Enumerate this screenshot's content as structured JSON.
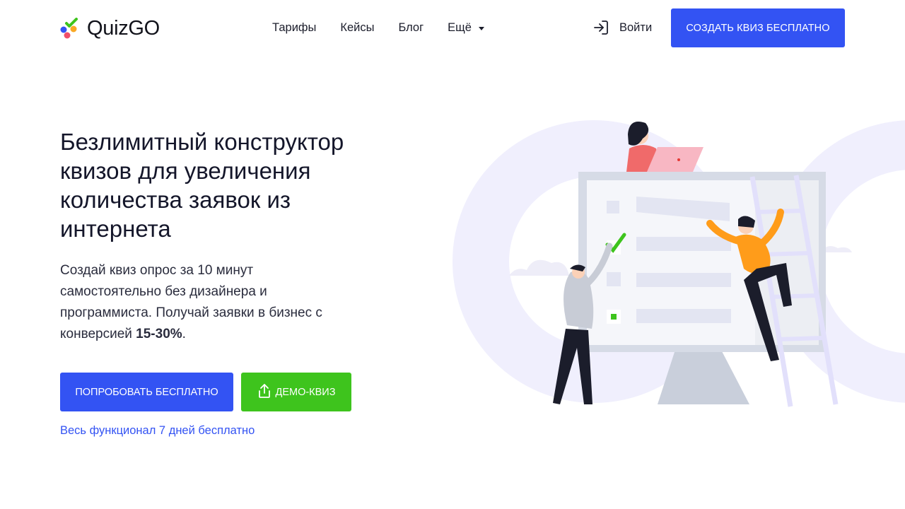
{
  "header": {
    "logo_text": "QuizGO",
    "nav": [
      {
        "label": "Тарифы"
      },
      {
        "label": "Кейсы"
      },
      {
        "label": "Блог"
      },
      {
        "label": "Ещё"
      }
    ],
    "login_label": "Войти",
    "cta_label": "СОЗДАТЬ КВИЗ БЕСПЛАТНО"
  },
  "hero": {
    "title": "Безлимитный конструктор квизов для увеличения количества заявок из интернета",
    "desc_text": "Создай квиз опрос за 10 минут самостоятельно без дизайнера и программиста. Получай заявки в бизнес с конверсией ",
    "desc_highlight": "15-30%",
    "desc_end": ".",
    "try_label": "ПОПРОБОВАТЬ БЕСПЛАТНО",
    "demo_label": "ДЕМО-КВИЗ",
    "trial_link": "Весь функционал 7 дней бесплатно"
  },
  "colors": {
    "primary": "#3353f3",
    "success": "#3ec41d",
    "text": "#1b1d2b"
  }
}
